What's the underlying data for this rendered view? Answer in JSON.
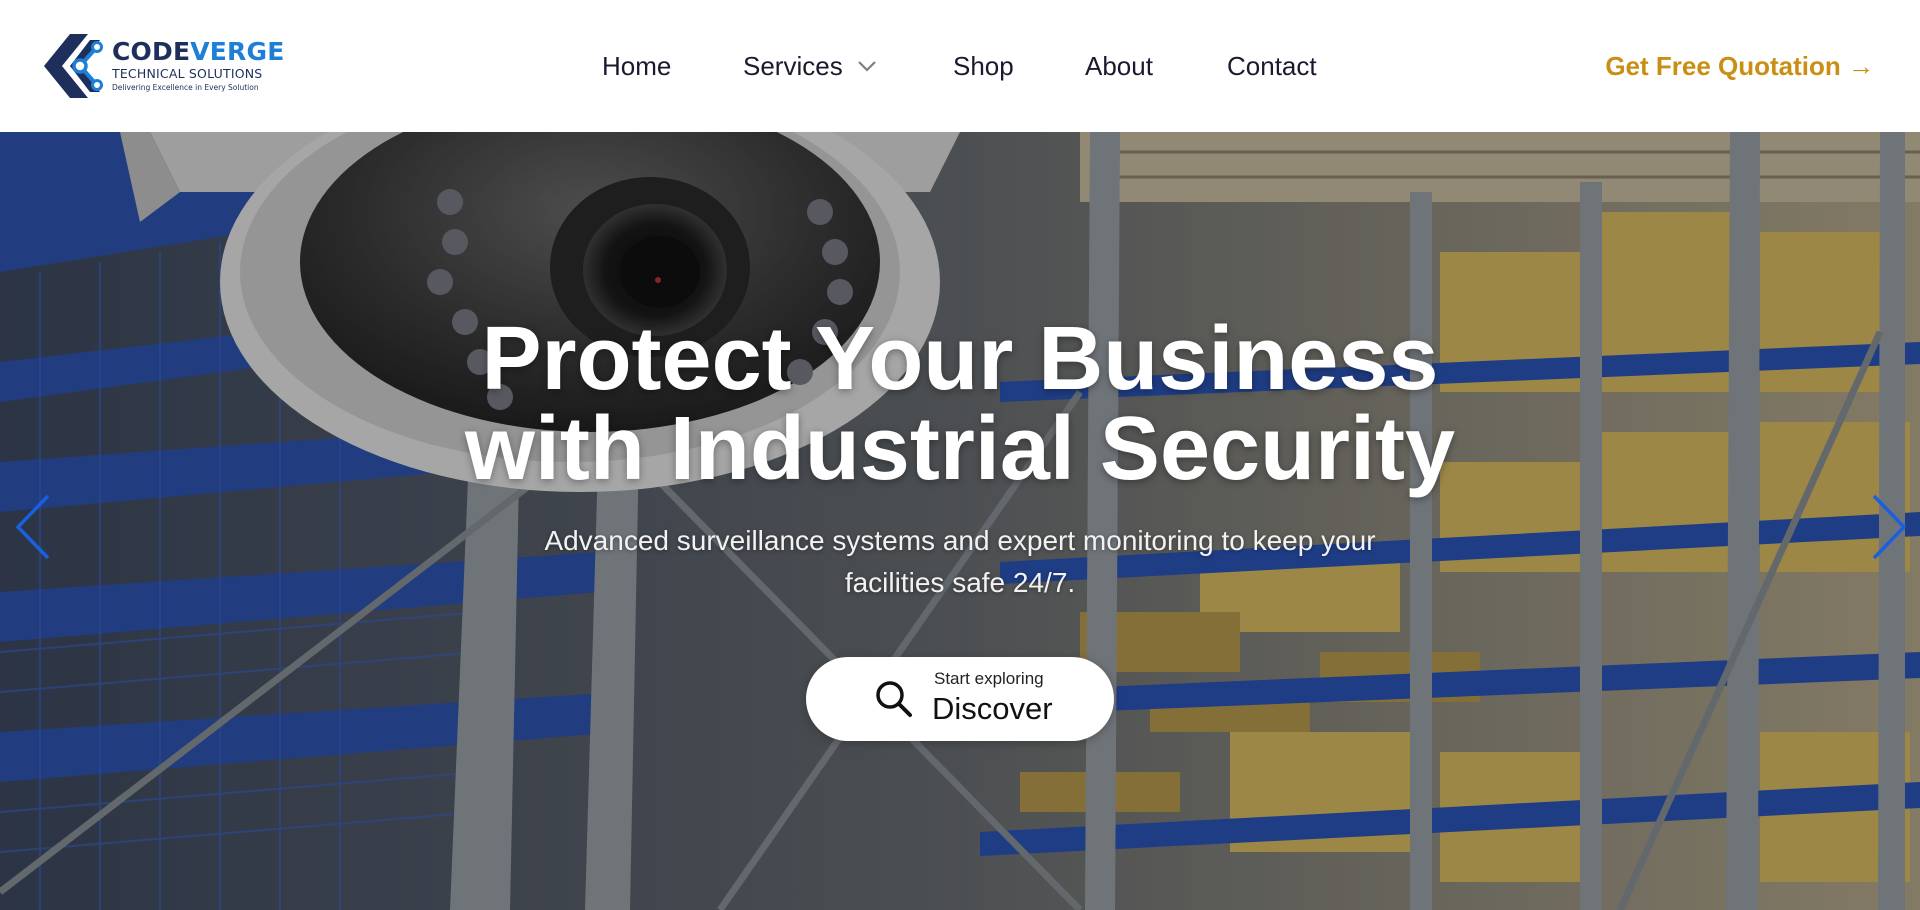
{
  "brand": {
    "name_part1": "CODE",
    "name_part2": "VERGE",
    "subtitle": "TECHNICAL SOLUTIONS",
    "tagline": "Delivering Excellence in Every Solution",
    "primary_color": "#1f2f5c",
    "accent_color": "#1e7fd6"
  },
  "nav": {
    "items": [
      {
        "label": "Home"
      },
      {
        "label": "Services",
        "has_dropdown": true
      },
      {
        "label": "Shop"
      },
      {
        "label": "About"
      },
      {
        "label": "Contact"
      }
    ]
  },
  "cta": {
    "label": "Get Free Quotation →",
    "color": "#c98f14"
  },
  "hero": {
    "headline_line1": "Protect Your Business",
    "headline_line2": "with Industrial Security",
    "subtext": "Advanced surveillance systems and expert monitoring to keep your facilities safe 24/7.",
    "button_small": "Start exploring",
    "button_big": "Discover",
    "button_icon": "search-icon",
    "prev_icon": "chevron-left-icon",
    "next_icon": "chevron-right-icon",
    "arrow_color": "#1a5fe0"
  }
}
